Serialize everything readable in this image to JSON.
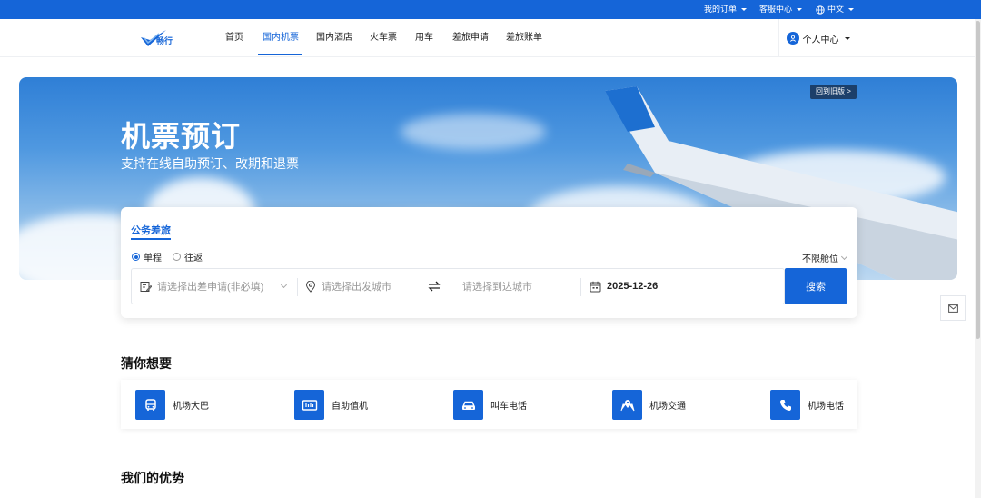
{
  "topbar": {
    "my_orders": "我的订单",
    "service_center": "客服中心",
    "language": "中文"
  },
  "nav": {
    "logo_text": "畅行",
    "links": [
      "首页",
      "国内机票",
      "国内酒店",
      "火车票",
      "用车",
      "差旅申请",
      "差旅账单"
    ],
    "active_index": 1,
    "user_center": "个人中心"
  },
  "hero": {
    "title": "机票预订",
    "subtitle": "支持在线自助预订、改期和退票",
    "old_version": "回到旧版 >"
  },
  "search": {
    "tab": "公务差旅",
    "one_way": "单程",
    "round_trip": "往返",
    "cabin": "不限舱位",
    "application_placeholder": "请选择出差申请(非必填)",
    "from_placeholder": "请选择出发城市",
    "to_placeholder": "请选择到达城市",
    "date": "2025-12-26",
    "search_label": "搜索"
  },
  "guess": {
    "title": "猜你想要",
    "items": [
      "机场大巴",
      "自助值机",
      "叫车电话",
      "机场交通",
      "机场电话"
    ]
  },
  "advantage": {
    "title": "我们的优势"
  },
  "colors": {
    "brand": "#1565d8"
  }
}
